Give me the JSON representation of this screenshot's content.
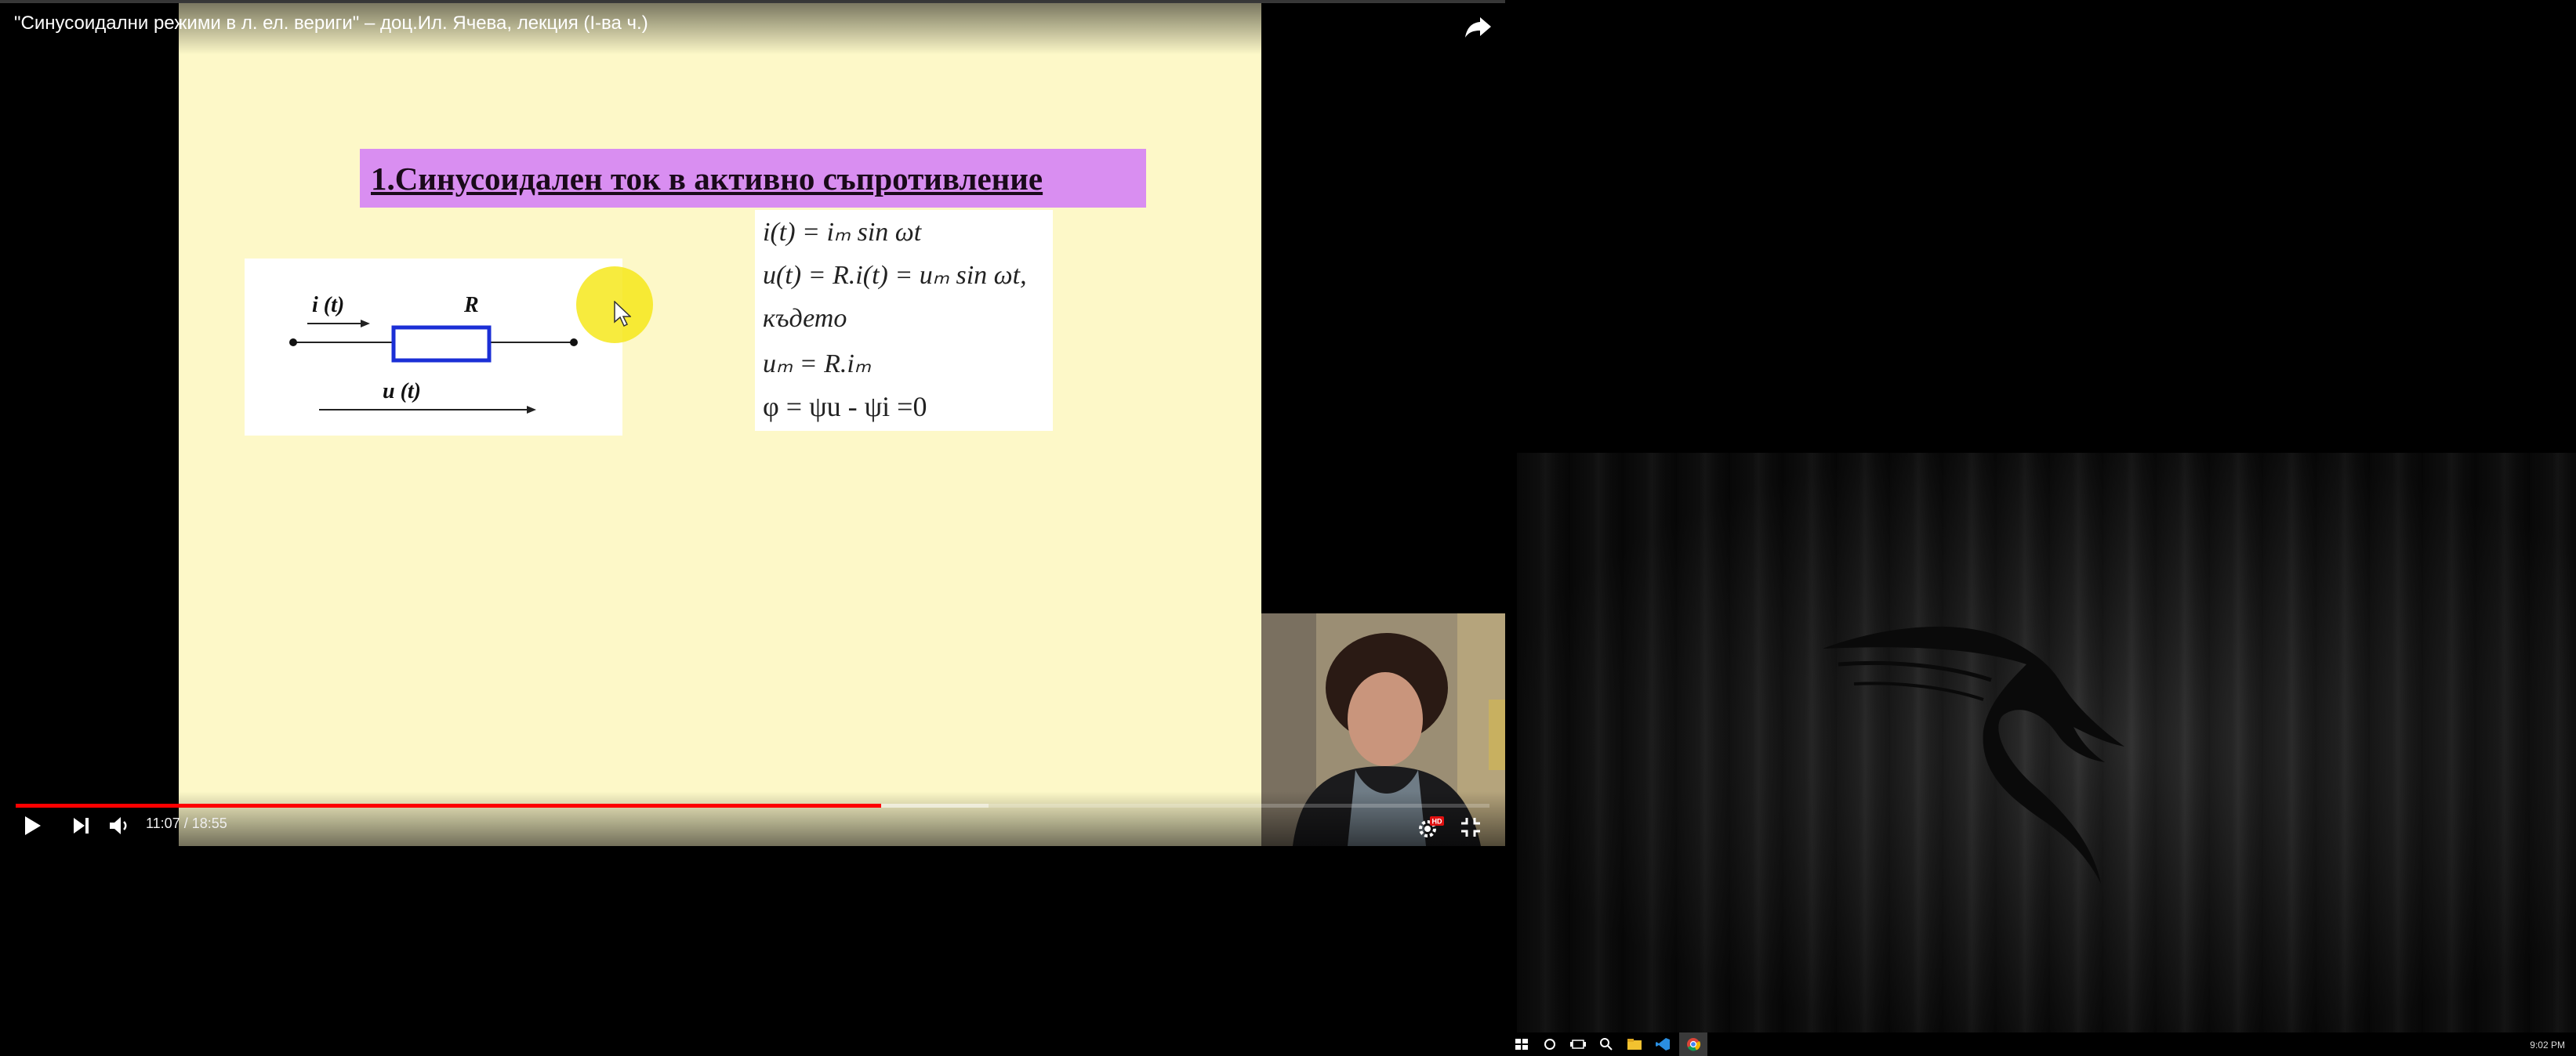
{
  "video": {
    "title": "\"Синусоидални режими в л. ел. вериги\" – доц.Ил. Ячева, лекция (I-ва ч.)",
    "time_display": "11:07 / 18:55",
    "played_fraction": 0.587,
    "buffered_fraction": 0.66,
    "hd_badge": "HD"
  },
  "slide": {
    "title": "1.Синусоидален ток в активно съпротивление",
    "circuit": {
      "current_label": "i (t)",
      "resistor_label": "R",
      "voltage_label": "u (t)"
    },
    "formulas": {
      "line1": "i(t) = iₘ sin ωt",
      "line2": "u(t) = R.i(t) = uₘ sin ωt,",
      "line3": "където",
      "line4": "uₘ = R.iₘ",
      "line5": "φ = ψu - ψi =0"
    }
  },
  "taskbar": {
    "clock": "9:02 PM",
    "icons": [
      "windows-start-icon",
      "cortana-icon",
      "task-view-icon",
      "search-icon",
      "file-explorer-icon",
      "vscode-icon",
      "chrome-icon"
    ]
  },
  "colors": {
    "progress_played": "#ff0000",
    "slide_background": "#fdf8c8",
    "slide_title_background": "#d98ef1",
    "resistor_stroke": "#1b2fd6"
  }
}
